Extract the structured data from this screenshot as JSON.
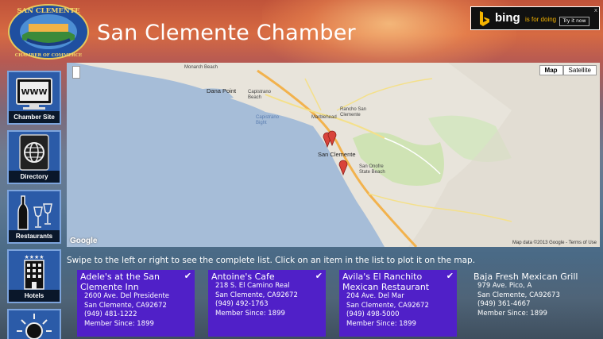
{
  "logo": {
    "top_text": "SAN CLEMENTE",
    "bottom_text": "CHAMBER OF COMMERCE"
  },
  "header": {
    "title": "San Clemente Chamber"
  },
  "ad": {
    "brand": "bing",
    "tagline": "is for doing",
    "button": "Try it now",
    "close": "x"
  },
  "nav": [
    {
      "label": "Chamber Site",
      "icon": "www-monitor-icon"
    },
    {
      "label": "Directory",
      "icon": "globe-book-icon"
    },
    {
      "label": "Restaurants",
      "icon": "wine-bottle-glasses-icon"
    },
    {
      "label": "Hotels",
      "icon": "hotel-building-icon"
    },
    {
      "label": "",
      "icon": "sun-icon"
    }
  ],
  "map": {
    "buttons": [
      "Map",
      "Satellite"
    ],
    "active_button": "Map",
    "attribution": "Map data ©2013 Google - Terms of Use",
    "logo": "Google",
    "places": {
      "monarch_beach": "Monarch Beach",
      "dana_point": "Dana Point",
      "capistrano_beach": "Capistrano Beach",
      "marblehead": "Marblehead",
      "capistrano_bight": "Capistrano Bight",
      "rancho_san_clemente": "Rancho San Clemente",
      "san_clemente": "San Clemente",
      "san_onofre": "San Onofre State Beach"
    }
  },
  "instructions": "Swipe to the left or right to see the complete list. Click on an item in the list to plot it on the map.",
  "cards": [
    {
      "name": "Adele's at the San Clemente Inn",
      "selected": true,
      "address": "2600 Ave. Del Presidente",
      "city": "San Clemente, CA92672",
      "phone": "(949) 481-1222",
      "member": "Member Since: 1899"
    },
    {
      "name": "Antoine's Cafe",
      "selected": true,
      "address": "218 S. El Camino Real",
      "city": "San Clemente, CA92672",
      "phone": "(949) 492-1763",
      "member": "Member Since: 1899"
    },
    {
      "name": "Avila's El Ranchito Mexican Restaurant",
      "selected": true,
      "address": "204 Ave. Del Mar",
      "city": "San Clemente, CA92672",
      "phone": "(949) 498-5000",
      "member": "Member Since: 1899"
    },
    {
      "name": "Baja Fresh Mexican Grill",
      "selected": false,
      "address": "979 Ave. Pico, A",
      "city": "San Clemente, CA92673",
      "phone": "(949) 361-4667",
      "member": "Member Since: 1899"
    }
  ],
  "colors": {
    "card_selected": "#5020c8",
    "tile": "#2b5ba8",
    "ocean": "#a6bdd8",
    "land": "#e8e4db",
    "park": "#cfe3b4",
    "pin": "#d9433a"
  }
}
